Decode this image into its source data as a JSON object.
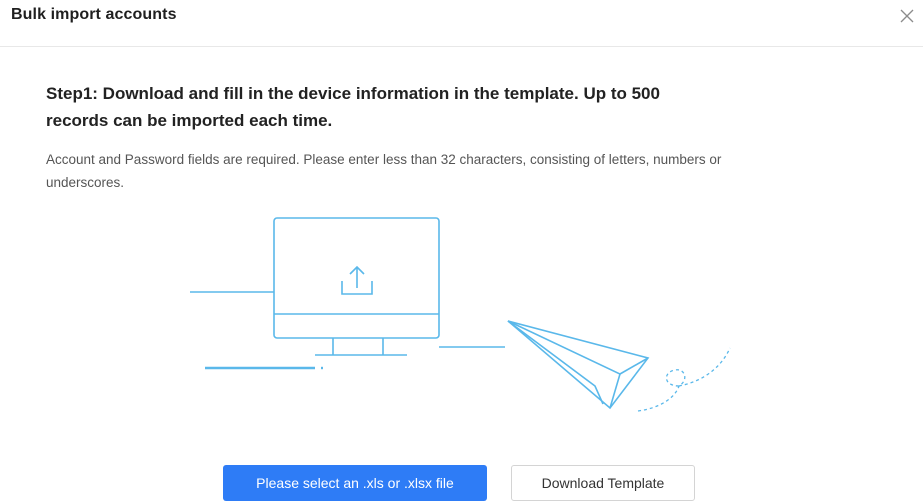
{
  "dialog": {
    "title": "Bulk import accounts",
    "close_icon": "close-icon"
  },
  "step1": {
    "title": "Step1: Download and fill in the device information in the template. Up to 500 records can be imported each time.",
    "description": "Account and Password fields are required. Please enter less than 32 characters, consisting of letters, numbers or underscores."
  },
  "illustration": {
    "icons": [
      "monitor-upload-icon",
      "paper-plane-icon"
    ],
    "accent_color": "#5ab8ea"
  },
  "actions": {
    "select_file_label": "Please select an .xls or .xlsx file",
    "download_template_label": "Download Template"
  },
  "colors": {
    "primary": "#2e7cf6",
    "illustration_stroke": "#5ab8ea"
  }
}
